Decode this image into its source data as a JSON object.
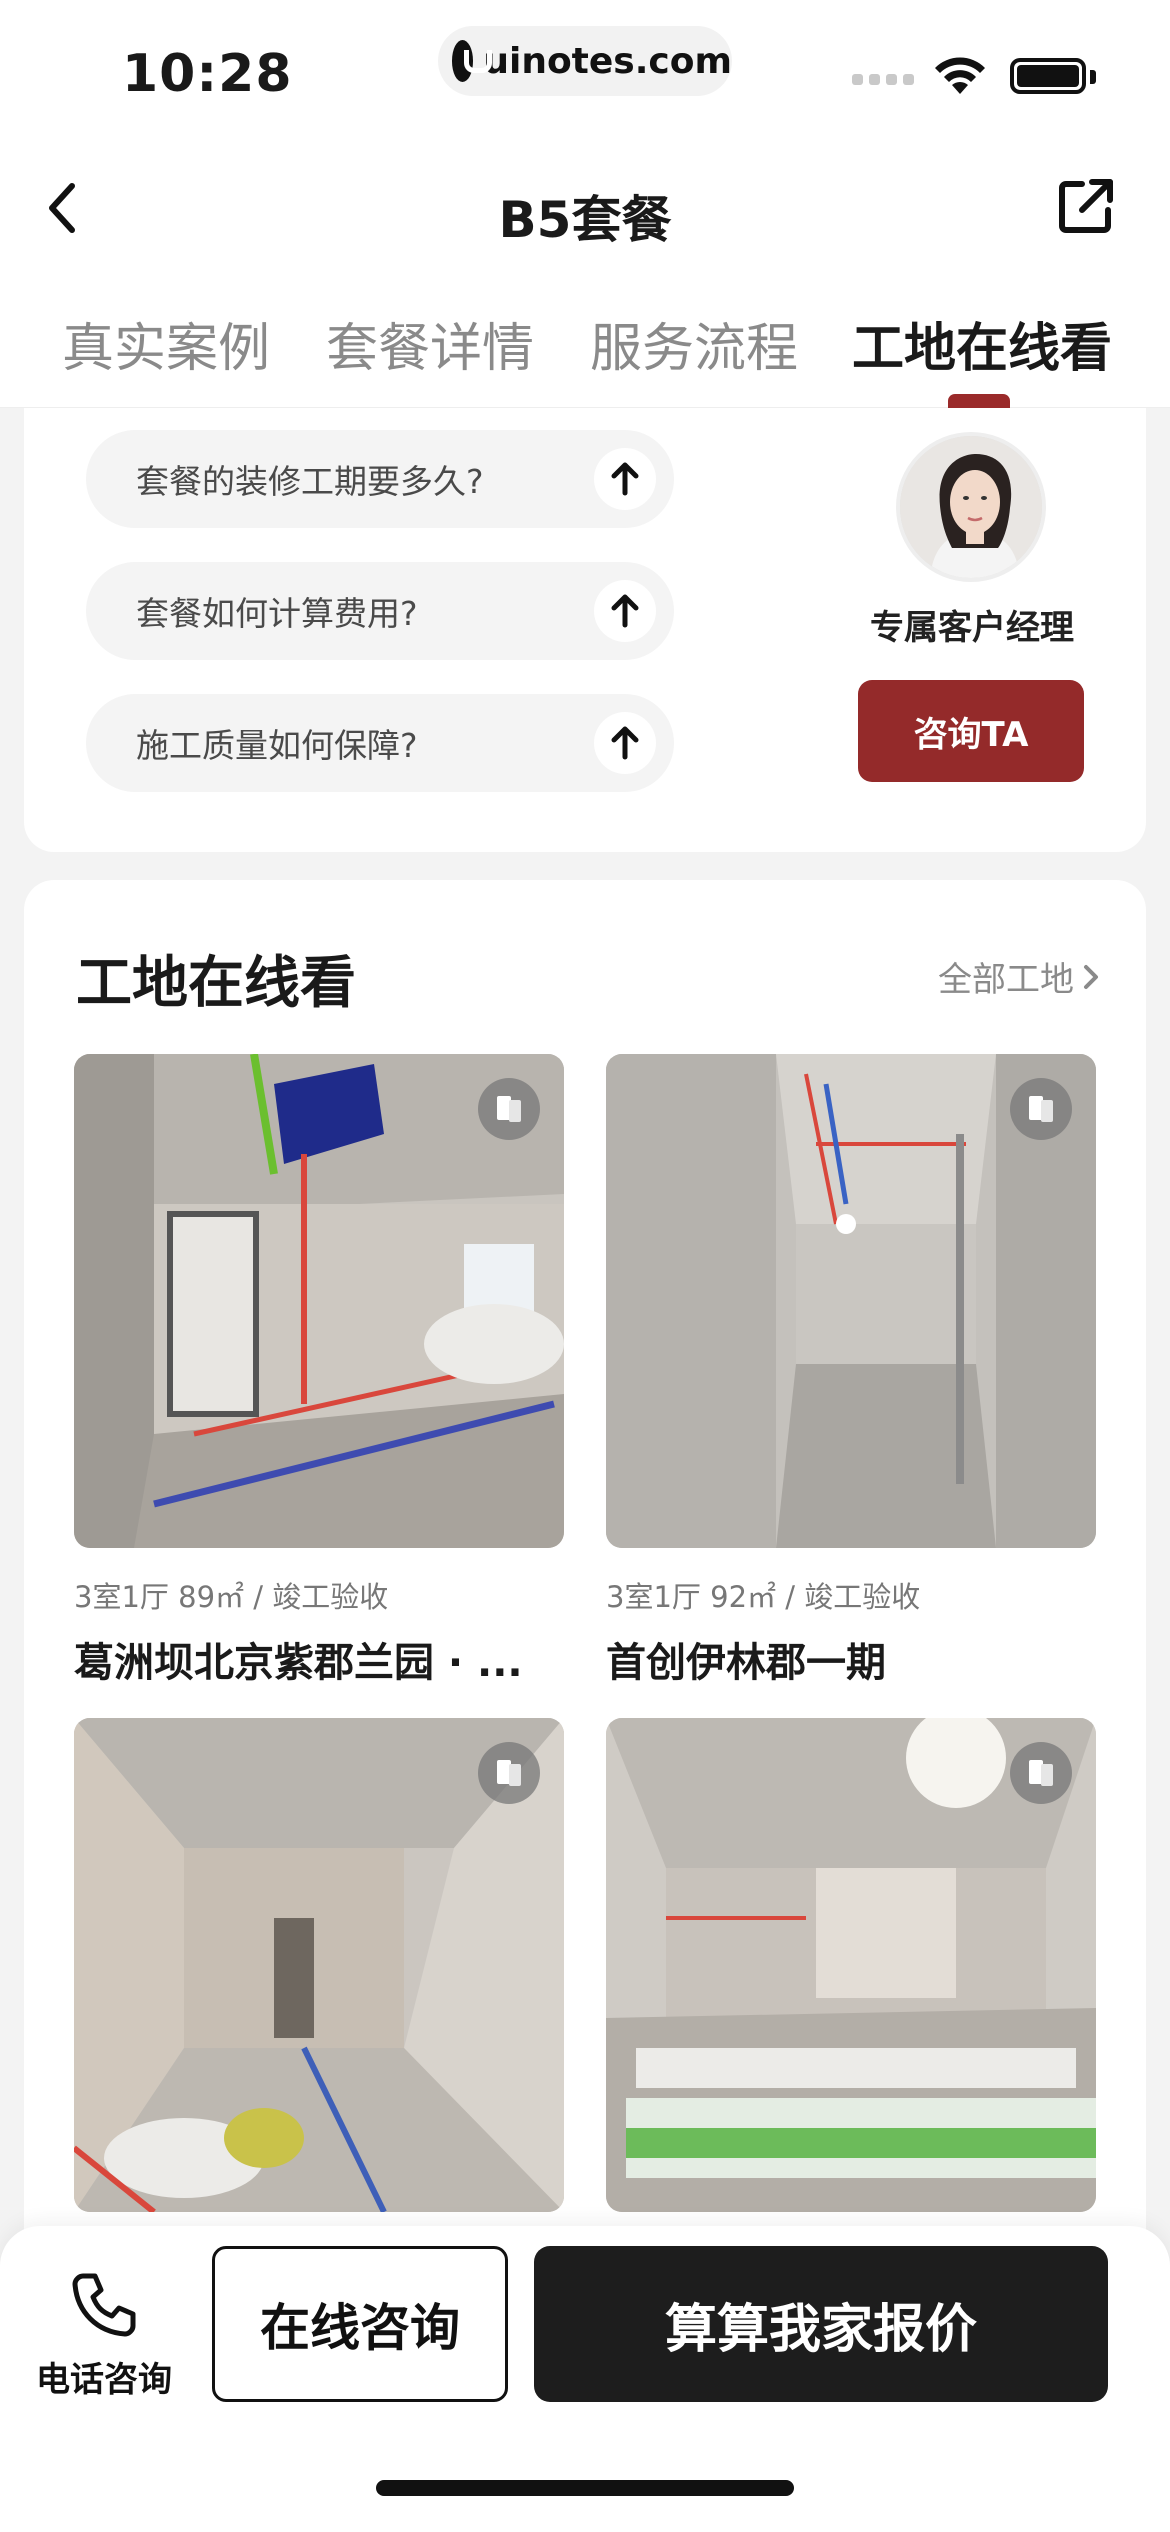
{
  "status_bar": {
    "time": "10:28",
    "url": "uinotes.com"
  },
  "navbar": {
    "title": "B5套餐",
    "back_icon": "chevron-left-icon",
    "share_icon": "share-external-icon"
  },
  "tabs": [
    {
      "label": "真实案例",
      "active": false
    },
    {
      "label": "套餐详情",
      "active": false
    },
    {
      "label": "服务流程",
      "active": false
    },
    {
      "label": "工地在线看",
      "active": true
    }
  ],
  "faq": {
    "questions": [
      "套餐的装修工期要多久?",
      "套餐如何计算费用?",
      "施工质量如何保障?"
    ],
    "advisor_label": "专属客户经理",
    "advisor_button": "咨询TA"
  },
  "sites": {
    "title": "工地在线看",
    "all_link": "全部工地",
    "items": [
      {
        "meta": "3室1厅 89㎡ / 竣工验收",
        "name": "葛洲坝北京紫郡兰园 · ..."
      },
      {
        "meta": "3室1厅 92㎡ / 竣工验收",
        "name": "首创伊林郡一期"
      },
      {
        "meta": "",
        "name": ""
      },
      {
        "meta": "",
        "name": ""
      }
    ]
  },
  "bottom_bar": {
    "phone_label": "电话咨询",
    "online_label": "在线咨询",
    "quote_label": "算算我家报价"
  },
  "colors": {
    "accent": "#942a2a",
    "dark_button": "#1d1d1d"
  }
}
